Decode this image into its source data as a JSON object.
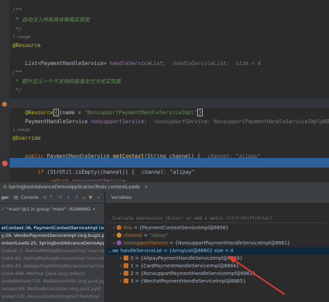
{
  "editor": {
    "lines": {
      "l1": "/**",
      "l2": " * 自动注入所有具体策略实现类",
      "l3": " */",
      "usage1": "1 usage",
      "l4_annot": "@Resource",
      "l5_type": "List<PaymentHandleService> ",
      "l5_field": "handleServiceList",
      "l5_semi": ";",
      "l5_hint": "handleServiceList:  size = 4",
      "l7": "/**",
      "l8": " * 额外定义一个不支持的渠道支付方式实现类",
      "l9": " */",
      "l10_annot": "@Resource",
      "l10_args": "(name = ",
      "l10_str": "\"NonsupportPaymentHandleServiceImpl\"",
      "l10_close": ")",
      "l11_type": "PaymentHandleService ",
      "l11_field": "nonsupportService",
      "l11_semi": ";",
      "l11_hint": "nonsupportService: NonsupportPaymentHandleServiceImpl@8861",
      "usage2": "1 usage",
      "l13_annot": "@Override",
      "l14_kw": "public ",
      "l14_type": "PaymentHandleService ",
      "l14_method": "getContext",
      "l14_params": "(String channel) {",
      "l14_hint": "channel: \"alipay\"",
      "l16_kw": "if ",
      "l16_expr": "(StrUtil.isEmpty(channel)) {",
      "l16_hint": "channel: \"alipay\"",
      "l17_kw": "return ",
      "l17_field": "nonsupportService",
      "l17_semi": ";"
    }
  },
  "runbar": {
    "title": "SpringbootAdvanceDemoApplicationTests.contextLoads"
  },
  "toolbar": {
    "debugger_tab": "ger",
    "console_tab": "Console",
    "variables_label": "Variables"
  },
  "threads": {
    "selected": "\"main\"@1 in group \"main\": RUNNING"
  },
  "frames": [
    "etContext:36, PaymentContextServiceImpl (org.",
    "y:29, VendorPaymentServiceImpl (org.bugiz.pt",
    "ontextLoads:25, SpringbootAdvanceDemoAppli",
    "ivoke0:-1, NativeMethodAccessorImpl (sun.refle",
    "ivoke:62, NativeMethodAccessorImpl (sun.refle",
    "ivoke:43, DelegatingMethodAccessorImpl (sun.",
    "ivoke:498, Method (java.lang.reflect)",
    "ivokeMethod:725, ReflectionUtils (org.junit.jup",
    "roceed:60, MethodInvocation (org.junit.jupit",
    "oceed:131, InvocationInterceptorChain$Val"
  ],
  "variables": {
    "eval_placeholder": "Evaluate expression (Enter) or add a watch (Ctrl+Shift+Enter)",
    "rows": [
      {
        "name": "this",
        "value": "{PaymentContextServiceImpl@8858}",
        "kind": "this"
      },
      {
        "name": "channel",
        "value": "\"alipay\"",
        "kind": "param"
      },
      {
        "name": "nonsupportService",
        "value": "{NonsupportPaymentHandleServiceImpl@8861}",
        "kind": "field"
      },
      {
        "name": "handleServiceList",
        "value": "{ArrayList@8860}  size = 4",
        "kind": "field"
      },
      {
        "name": "0",
        "value": "{AlipayPaymentHandleServiceImpl@8863}",
        "kind": "item"
      },
      {
        "name": "1",
        "value": "{CardPaymentHandleServiceImpl@8864}",
        "kind": "item"
      },
      {
        "name": "2",
        "value": "{NonsupportPaymentHandleServiceImpl@8861}",
        "kind": "item"
      },
      {
        "name": "3",
        "value": "{WechatPaymentHandleServiceImpl@8865}",
        "kind": "item"
      }
    ]
  },
  "colors": {
    "highlight_line": "#2d6099",
    "annotation_arrow": "#e03c31"
  }
}
